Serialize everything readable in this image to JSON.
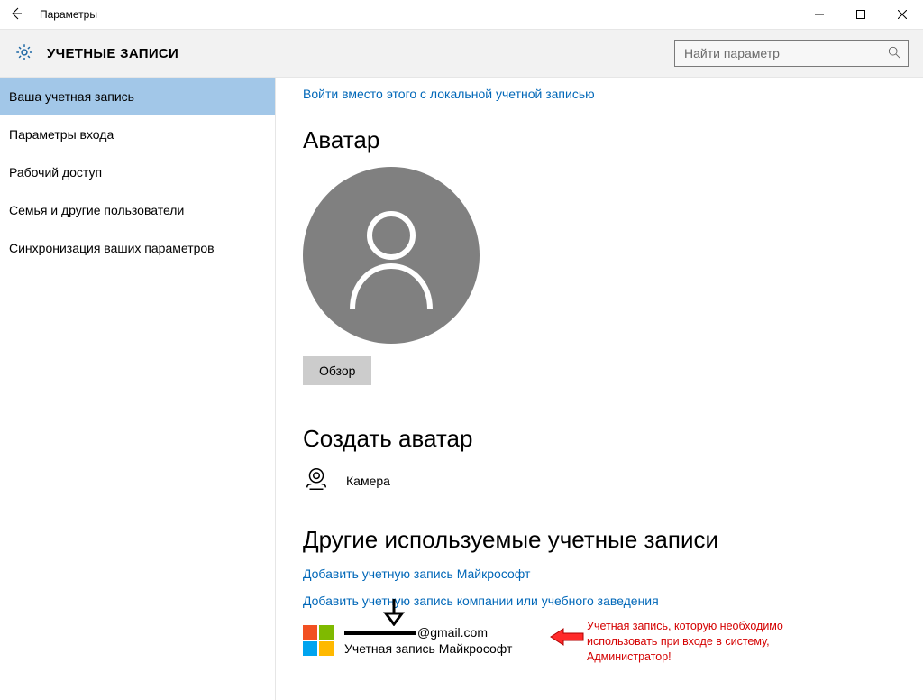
{
  "window": {
    "title": "Параметры"
  },
  "header": {
    "title": "УЧЕТНЫЕ ЗАПИСИ",
    "search_placeholder": "Найти параметр"
  },
  "sidebar": {
    "items": [
      {
        "label": "Ваша учетная запись",
        "active": true
      },
      {
        "label": "Параметры входа",
        "active": false
      },
      {
        "label": "Рабочий доступ",
        "active": false
      },
      {
        "label": "Семья и другие пользователи",
        "active": false
      },
      {
        "label": "Синхронизация ваших параметров",
        "active": false
      }
    ]
  },
  "content": {
    "local_link": "Войти вместо этого с локальной учетной записью",
    "avatar_heading": "Аватар",
    "browse_label": "Обзор",
    "create_avatar_heading": "Создать аватар",
    "camera_label": "Камера",
    "other_accounts_heading": "Другие используемые учетные записи",
    "add_ms_link": "Добавить учетную запись Майкрософт",
    "add_work_link": "Добавить учетную запись компании или учебного заведения",
    "account": {
      "email_suffix": "@gmail.com",
      "subtitle": "Учетная запись Майкрософт"
    }
  },
  "annotation": {
    "text": "Учетная запись, которую необходимо использовать при входе в систему, Администратор!"
  }
}
